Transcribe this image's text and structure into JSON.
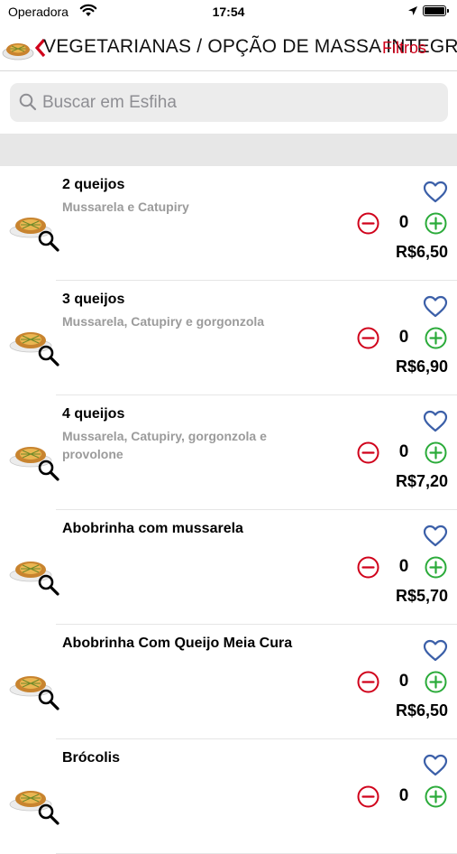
{
  "status_bar": {
    "carrier": "Operadora",
    "time": "17:54"
  },
  "nav": {
    "back_icon": "chevron-left-icon",
    "title": "VEGETARIANAS / OPÇÃO DE MASSA INTEGRAL",
    "filter_label": "Filtros",
    "accent_color": "#d0021b"
  },
  "search": {
    "placeholder": "Buscar em Esfiha",
    "value": ""
  },
  "items": [
    {
      "name": "2 queijos",
      "description": "Mussarela e Catupiry",
      "quantity": "0",
      "price": "R$6,50",
      "thumb": "esfiha-plate"
    },
    {
      "name": "3 queijos",
      "description": "Mussarela, Catupiry e gorgonzola",
      "quantity": "0",
      "price": "R$6,90",
      "thumb": "esfiha-photo"
    },
    {
      "name": "4 queijos",
      "description": "Mussarela, Catupiry, gorgonzola e provolone",
      "quantity": "0",
      "price": "R$7,20",
      "thumb": "esfiha-plate"
    },
    {
      "name": "Abobrinha com mussarela",
      "description": "",
      "quantity": "0",
      "price": "R$5,70",
      "thumb": "esfiha-plate"
    },
    {
      "name": "Abobrinha Com Queijo Meia Cura",
      "description": "",
      "quantity": "0",
      "price": "R$6,50",
      "thumb": "esfiha-round"
    },
    {
      "name": "Brócolis",
      "description": "",
      "quantity": "0",
      "price": "",
      "thumb": "esfiha-plate"
    }
  ],
  "colors": {
    "minus": "#d0021b",
    "plus": "#2bab3a",
    "heart": "#3b5fa8",
    "description": "#9b9b9b"
  }
}
